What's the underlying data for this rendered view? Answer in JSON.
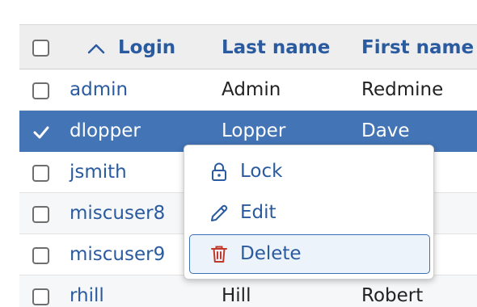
{
  "table": {
    "columns": {
      "login": "Login",
      "last_name": "Last name",
      "first_name": "First name"
    },
    "sort_indicator": "ascending",
    "rows": [
      {
        "login": "admin",
        "last_name": "Admin",
        "first_name": "Redmine",
        "checked": false
      },
      {
        "login": "dlopper",
        "last_name": "Lopper",
        "first_name": "Dave",
        "checked": true
      },
      {
        "login": "jsmith",
        "last_name": "",
        "first_name": "",
        "checked": false
      },
      {
        "login": "miscuser8",
        "last_name": "",
        "first_name": "",
        "checked": false
      },
      {
        "login": "miscuser9",
        "last_name": "",
        "first_name": "",
        "checked": false
      },
      {
        "login": "rhill",
        "last_name": "Hill",
        "first_name": "Robert",
        "checked": false
      }
    ]
  },
  "context_menu": {
    "items": [
      {
        "label": "Lock",
        "icon": "lock-icon"
      },
      {
        "label": "Edit",
        "icon": "pencil-icon"
      },
      {
        "label": "Delete",
        "icon": "trash-icon",
        "highlighted": true
      }
    ]
  },
  "colors": {
    "link": "#2a5a9f",
    "selected_row": "#4274b6",
    "delete_icon": "#c0392b"
  }
}
